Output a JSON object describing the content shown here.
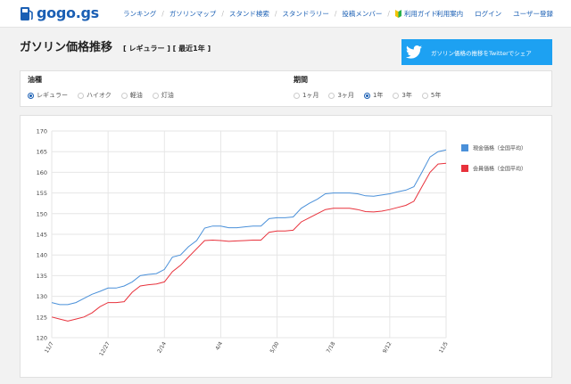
{
  "brand": {
    "name": "gogo.gs",
    "color": "#1a5fb4"
  },
  "nav": {
    "links": [
      "ランキング",
      "ガソリンマップ",
      "スタンド検索",
      "スタンドラリー",
      "投稿メンバー",
      "利用ガイド"
    ],
    "right_links": [
      "利用案内",
      "ログイン",
      "ユーザー登録"
    ]
  },
  "page": {
    "title": "ガソリン価格推移",
    "subtitle": "[ レギュラー ] [ 最近1年 ]",
    "share_label": "ガソリン価格の推移をTwitterでシェア"
  },
  "filters": {
    "fuel": {
      "title": "油種",
      "options": [
        "レギュラー",
        "ハイオク",
        "軽油",
        "灯油"
      ],
      "selected": 0
    },
    "period": {
      "title": "期間",
      "options": [
        "1ヶ月",
        "3ヶ月",
        "1年",
        "3年",
        "5年"
      ],
      "selected": 2
    }
  },
  "colors": {
    "cash": "#4a90d9",
    "member": "#e8323c",
    "twitter": "#1da1f2"
  },
  "chart_data": {
    "type": "line",
    "ylim": [
      120,
      170
    ],
    "yticks": [
      120,
      125,
      130,
      135,
      140,
      145,
      150,
      155,
      160,
      165,
      170
    ],
    "x_tick_labels": [
      "11/7",
      "12/27",
      "2/14",
      "4/4",
      "5/30",
      "7/18",
      "9/12",
      "11/5"
    ],
    "grid": true,
    "legend": "right",
    "series": [
      {
        "name": "現金価格（全国平均）",
        "color": "#4a90d9",
        "values": [
          128.5,
          128.0,
          128.0,
          128.5,
          129.5,
          130.5,
          131.2,
          132.0,
          132.0,
          132.5,
          133.5,
          135.0,
          135.3,
          135.5,
          136.5,
          139.5,
          140.0,
          142.0,
          143.5,
          146.5,
          147.0,
          147.0,
          146.6,
          146.6,
          146.8,
          147.0,
          147.0,
          148.8,
          149.0,
          149.0,
          149.2,
          151.3,
          152.5,
          153.5,
          154.8,
          155.0,
          155.0,
          155.0,
          154.8,
          154.3,
          154.2,
          154.5,
          154.8,
          155.3,
          155.7,
          156.5,
          160.0,
          163.7,
          165.0,
          165.4
        ]
      },
      {
        "name": "会員価格（全国平均）",
        "color": "#e8323c",
        "values": [
          125.0,
          124.5,
          124.0,
          124.5,
          125.0,
          126.0,
          127.5,
          128.5,
          128.5,
          128.7,
          131.0,
          132.5,
          132.8,
          133.0,
          133.5,
          136.0,
          137.5,
          139.5,
          141.5,
          143.5,
          143.6,
          143.5,
          143.3,
          143.4,
          143.5,
          143.6,
          143.6,
          145.5,
          145.8,
          145.8,
          146.0,
          148.0,
          149.0,
          150.0,
          151.0,
          151.3,
          151.3,
          151.3,
          151.0,
          150.5,
          150.4,
          150.6,
          151.0,
          151.5,
          152.0,
          153.0,
          156.5,
          160.0,
          162.0,
          162.2
        ]
      }
    ]
  }
}
